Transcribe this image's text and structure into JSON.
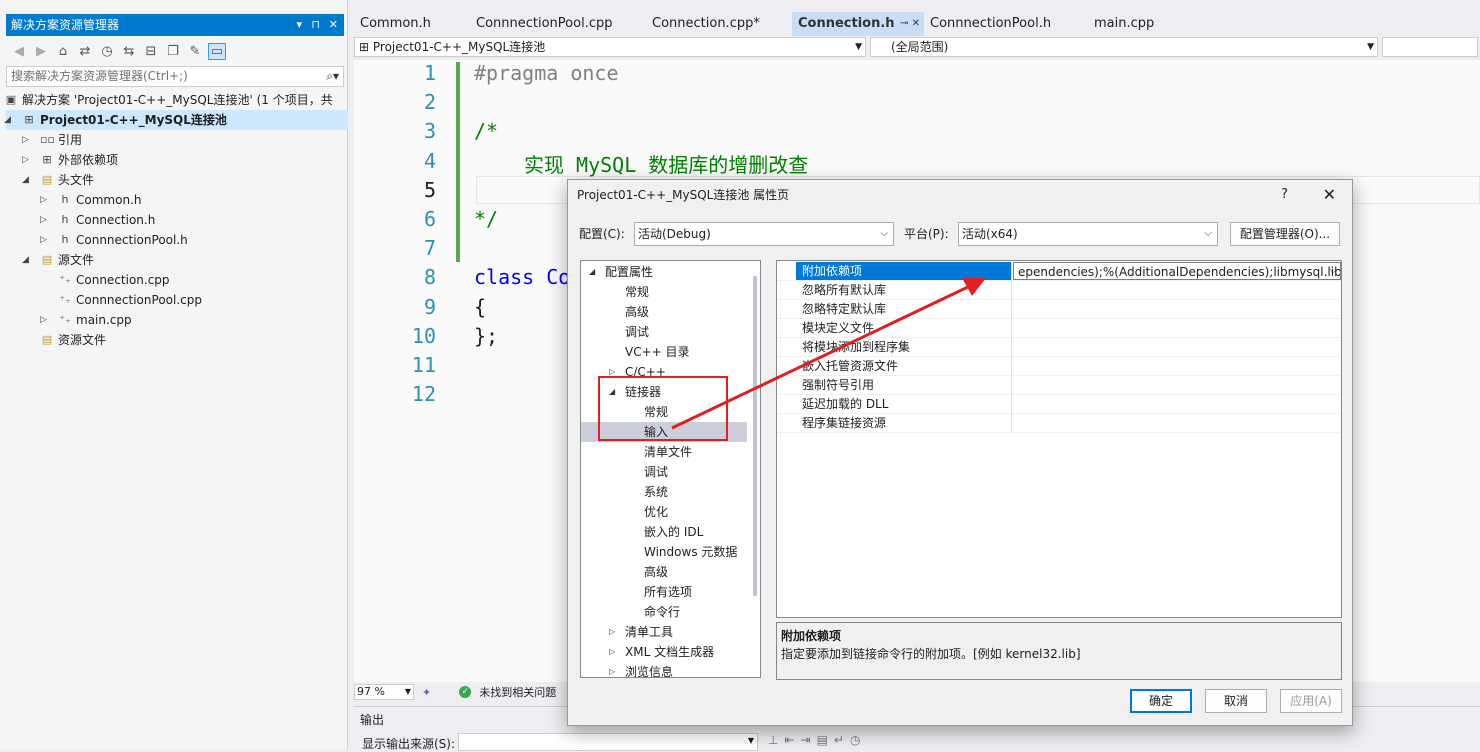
{
  "solution_explorer": {
    "title": "解决方案资源管理器",
    "title_buttons": [
      "▾",
      "⊓",
      "✕"
    ],
    "search_placeholder": "搜索解决方案资源管理器(Ctrl+;)",
    "toolbar_icons": [
      "back-icon",
      "forward-icon",
      "home-icon",
      "switch-views-icon",
      "history-icon",
      "sync-icon",
      "collapse-icon",
      "copy-icon",
      "wrench-icon",
      "preview-icon"
    ],
    "items": [
      {
        "label": "解决方案 'Project01-C++_MySQL连接池' (1 个项目，共",
        "icon": "solution-icon",
        "arrow": ""
      },
      {
        "label": "Project01-C++_MySQL连接池",
        "icon": "project-icon",
        "arrow": "◢"
      },
      {
        "label": "引用",
        "icon": "references-icon",
        "arrow": "▷"
      },
      {
        "label": "外部依赖项",
        "icon": "external-deps-icon",
        "arrow": "▷"
      },
      {
        "label": "头文件",
        "icon": "folder-icon",
        "arrow": "◢"
      },
      {
        "label": "Common.h",
        "icon": "header-file-icon",
        "arrow": "▷"
      },
      {
        "label": "Connection.h",
        "icon": "header-file-icon",
        "arrow": "▷"
      },
      {
        "label": "ConnnectionPool.h",
        "icon": "header-file-icon",
        "arrow": "▷"
      },
      {
        "label": "源文件",
        "icon": "folder-icon",
        "arrow": "◢"
      },
      {
        "label": "Connection.cpp",
        "icon": "cpp-file-icon",
        "arrow": ""
      },
      {
        "label": "ConnnectionPool.cpp",
        "icon": "cpp-file-icon",
        "arrow": ""
      },
      {
        "label": "main.cpp",
        "icon": "cpp-file-icon",
        "arrow": "▷"
      },
      {
        "label": "资源文件",
        "icon": "folder-icon",
        "arrow": ""
      }
    ]
  },
  "editor": {
    "tabs": [
      "Common.h",
      "ConnnectionPool.cpp",
      "Connection.cpp*",
      "Connection.h",
      "ConnnectionPool.h",
      "main.cpp"
    ],
    "active_tab_pin": "⊸ ✕",
    "nav_project": "Project01-C++_MySQL连接池",
    "nav_scope": "(全局范围)",
    "line_numbers": [
      "1",
      "2",
      "3",
      "4",
      "5",
      "6",
      "7",
      "8",
      "9",
      "10",
      "11",
      "12"
    ],
    "lines": [
      "#pragma once",
      "",
      "/*",
      "实现 MySQL 数据库的增删改查",
      "",
      "*/",
      "",
      "class Co",
      "{",
      "};",
      "",
      ""
    ],
    "zoom": "97 %",
    "status_text": "未找到相关问题",
    "output_title": "输出",
    "output_source_label": "显示输出来源(S):"
  },
  "dialog": {
    "title": "Project01-C++_MySQL连接池 属性页",
    "help": "?",
    "close": "✕",
    "config_label": "配置(C):",
    "config_value": "活动(Debug)",
    "platform_label": "平台(P):",
    "platform_value": "活动(x64)",
    "config_manager": "配置管理器(O)...",
    "tree": [
      {
        "label": "配置属性",
        "arrow": "◢",
        "indent": 0
      },
      {
        "label": "常规",
        "arrow": "",
        "indent": 1
      },
      {
        "label": "高级",
        "arrow": "",
        "indent": 1
      },
      {
        "label": "调试",
        "arrow": "",
        "indent": 1
      },
      {
        "label": "VC++ 目录",
        "arrow": "",
        "indent": 1
      },
      {
        "label": "C/C++",
        "arrow": "▷",
        "indent": 1
      },
      {
        "label": "链接器",
        "arrow": "◢",
        "indent": 1
      },
      {
        "label": "常规",
        "arrow": "",
        "indent": 2
      },
      {
        "label": "输入",
        "arrow": "",
        "indent": 2
      },
      {
        "label": "清单文件",
        "arrow": "",
        "indent": 2
      },
      {
        "label": "调试",
        "arrow": "",
        "indent": 2
      },
      {
        "label": "系统",
        "arrow": "",
        "indent": 2
      },
      {
        "label": "优化",
        "arrow": "",
        "indent": 2
      },
      {
        "label": "嵌入的 IDL",
        "arrow": "",
        "indent": 2
      },
      {
        "label": "Windows 元数据",
        "arrow": "",
        "indent": 2
      },
      {
        "label": "高级",
        "arrow": "",
        "indent": 2
      },
      {
        "label": "所有选项",
        "arrow": "",
        "indent": 2
      },
      {
        "label": "命令行",
        "arrow": "",
        "indent": 2
      },
      {
        "label": "清单工具",
        "arrow": "▷",
        "indent": 1
      },
      {
        "label": "XML 文档生成器",
        "arrow": "▷",
        "indent": 1
      },
      {
        "label": "浏览信息",
        "arrow": "▷",
        "indent": 1
      }
    ],
    "properties": [
      {
        "key": "附加依赖项",
        "value": "ependencies);%(AdditionalDependencies);libmysql.lib"
      },
      {
        "key": "忽略所有默认库",
        "value": ""
      },
      {
        "key": "忽略特定默认库",
        "value": ""
      },
      {
        "key": "模块定义文件",
        "value": ""
      },
      {
        "key": "将模块添加到程序集",
        "value": ""
      },
      {
        "key": "嵌入托管资源文件",
        "value": ""
      },
      {
        "key": "强制符号引用",
        "value": ""
      },
      {
        "key": "延迟加载的 DLL",
        "value": ""
      },
      {
        "key": "程序集链接资源",
        "value": ""
      }
    ],
    "desc_title": "附加依赖项",
    "desc_text": "指定要添加到链接命令行的附加项。[例如 kernel32.lib]",
    "ok": "确定",
    "cancel": "取消",
    "apply": "应用(A)"
  },
  "colors": {
    "accent": "#007acc",
    "annotation": "#e02020",
    "selection": "#0078d7",
    "keyword": "#0000ff",
    "comment": "#008000"
  }
}
